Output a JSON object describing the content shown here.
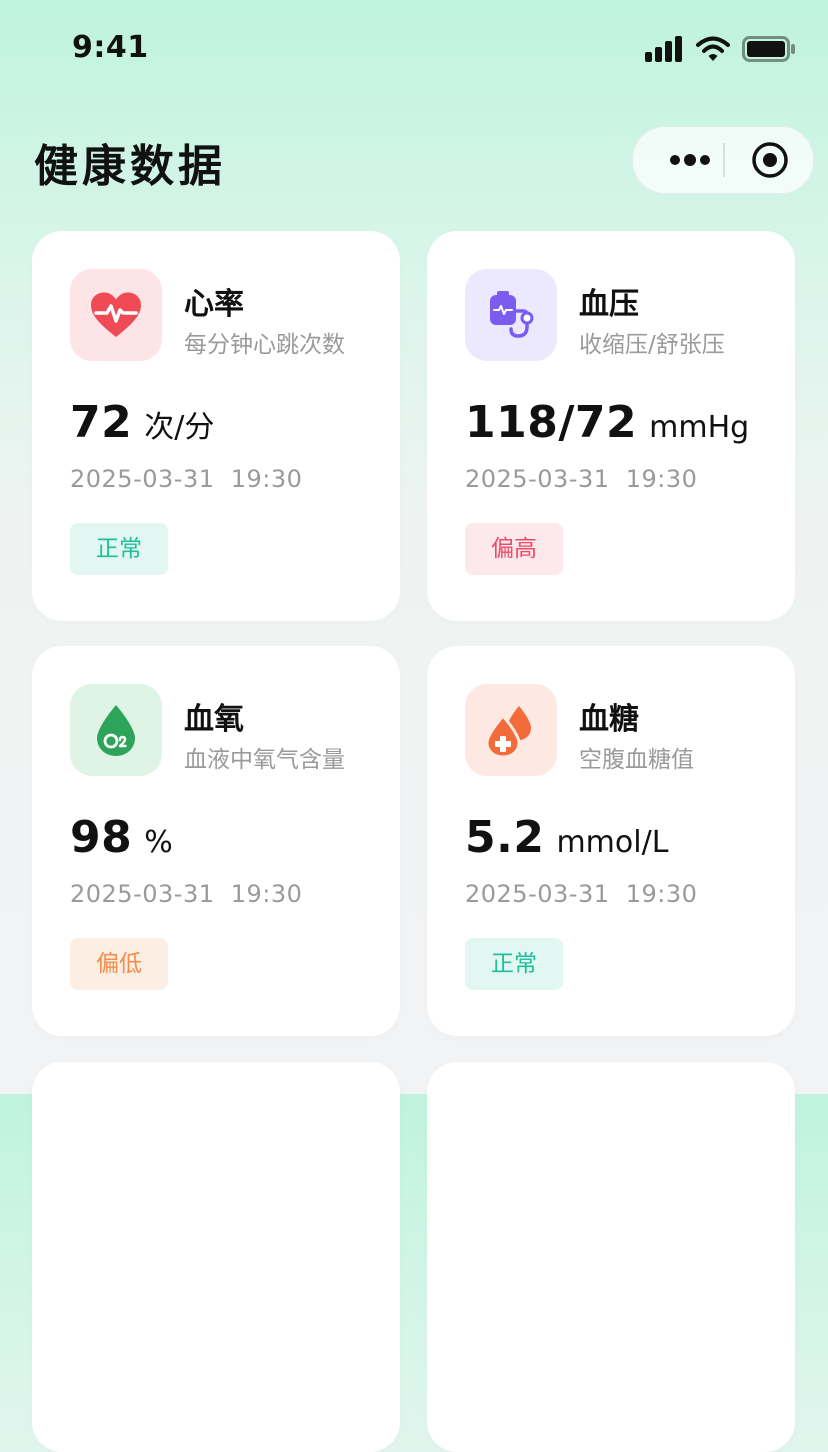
{
  "status_bar": {
    "time": "9:41"
  },
  "header": {
    "title": "健康数据"
  },
  "cards": [
    {
      "name": "心率",
      "desc": "每分钟心跳次数",
      "value": "72",
      "unit": "次/分",
      "time": "2025-03-31  19:30",
      "status": "正常",
      "status_color": "#1fbf9a",
      "icon": "heart-rate-icon",
      "icon_bg": "#fde4e6",
      "icon_color": "#ef4a55"
    },
    {
      "name": "血压",
      "desc": "收缩压/舒张压",
      "value": "118/72",
      "unit": "mmHg",
      "time": "2025-03-31  19:30",
      "status": "偏高",
      "status_color": "#ef4a67",
      "icon": "blood-pressure-icon",
      "icon_bg": "#ece8fd",
      "icon_color": "#7b5cf0"
    },
    {
      "name": "血氧",
      "desc": "血液中氧气含量",
      "value": "98",
      "unit": "%",
      "time": "2025-03-31  19:30",
      "status": "偏低",
      "status_color": "#f58c4a",
      "icon": "oxygen-drop-icon",
      "icon_bg": "#e0f4e6",
      "icon_color": "#2ea45a"
    },
    {
      "name": "血糖",
      "desc": "空腹血糖值",
      "value": "5.2",
      "unit": "mmol/L",
      "time": "2025-03-31  19:30",
      "status": "正常",
      "status_color": "#1fbf9a",
      "icon": "blood-sugar-icon",
      "icon_bg": "#fde9e1",
      "icon_color": "#f26b3a"
    }
  ]
}
